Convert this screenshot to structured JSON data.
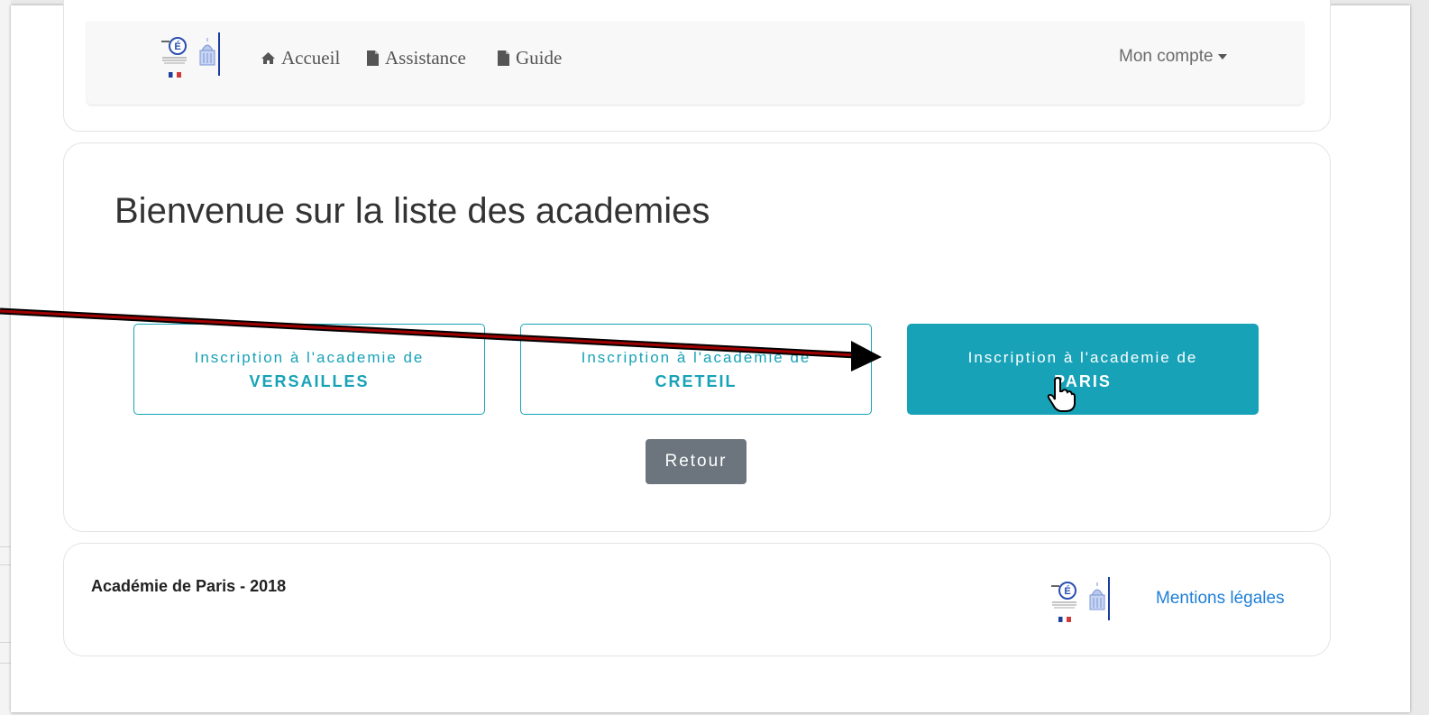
{
  "navbar": {
    "links": [
      {
        "label": "Accueil",
        "icon": "home-icon"
      },
      {
        "label": "Assistance",
        "icon": "file-icon"
      },
      {
        "label": "Guide",
        "icon": "file-icon"
      }
    ],
    "account_label": "Mon compte"
  },
  "main": {
    "title": "Bienvenue sur la liste des academies",
    "academies": [
      {
        "prefix": "Inscription à l'academie de",
        "name": "VERSAILLES",
        "active": false
      },
      {
        "prefix": "Inscription à l'academie de",
        "name": "CRETEIL",
        "active": false
      },
      {
        "prefix": "Inscription à l'academie de",
        "name": "PARIS",
        "active": true
      }
    ],
    "back_label": "Retour"
  },
  "footer": {
    "text": "Académie de Paris - 2018",
    "legal_link": "Mentions légales"
  },
  "colors": {
    "accent": "#17a2b8",
    "secondary": "#6c757d",
    "link": "#1e7fd8",
    "annotation_arrow": "#8b0000"
  }
}
